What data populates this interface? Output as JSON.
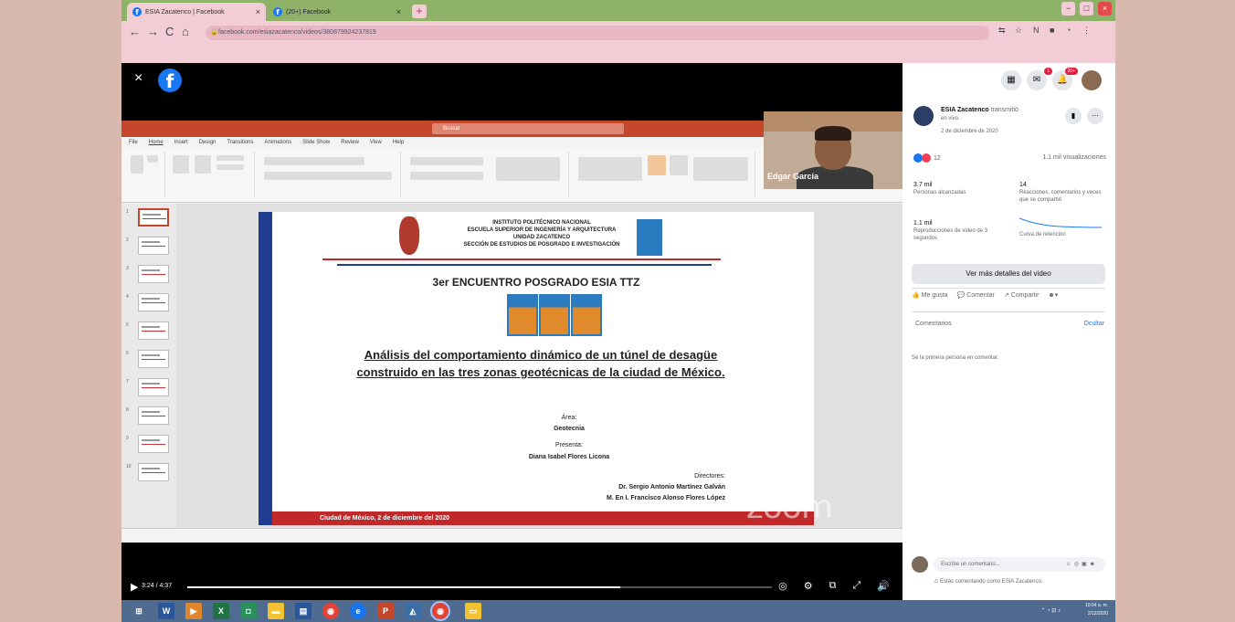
{
  "browser": {
    "tabs": [
      {
        "label": "ESIA Zacatenco | Facebook",
        "active": true
      },
      {
        "label": "(20+) Facebook",
        "active": false
      }
    ],
    "url": "facebook.com/esiazacatenco/videos/380879924237819",
    "new_tab": "+",
    "nav": {
      "back": "←",
      "forward": "→",
      "reload": "C",
      "home": "⌂"
    },
    "window_controls": [
      "−",
      "□",
      "×"
    ]
  },
  "player": {
    "close": "×",
    "logo": "f",
    "time": "3:24 / 4:37",
    "progress": 0.74,
    "icons": [
      "settings-icon",
      "fullscreen-icon",
      "expand-icon",
      "volume-icon"
    ]
  },
  "ppt": {
    "search_placeholder": "Buscar",
    "tabs": [
      "File",
      "Home",
      "Insert",
      "Design",
      "Transitions",
      "Animations",
      "Slide Show",
      "Review",
      "View",
      "Help"
    ],
    "slide_count": 10
  },
  "slide": {
    "institution": [
      "INSTITUTO POLITÉCNICO NACIONAL",
      "ESCUELA SUPERIOR DE INGENIERÍA Y ARQUITECTURA",
      "UNIDAD ZACATENCO",
      "SECCIÓN DE ESTUDIOS DE POSGRADO E INVESTIGACIÓN"
    ],
    "event": "3er ENCUENTRO POSGRADO ESIA TTZ",
    "title": "Análisis del comportamiento dinámico de un túnel de desagüe construido en las tres zonas geotécnicas de la ciudad de México.",
    "area_label": "Área:",
    "area": "Geotecnia",
    "presenta_label": "Presenta:",
    "presenter": "Diana Isabel Flores Licona",
    "directors_label": "Directores:",
    "director1": "Dr. Sergio Antonio Martínez Galván",
    "director2": "M. En I. Francisco Alonso Flores López",
    "footer": "Ciudad de México, 2 de diciembre del 2020"
  },
  "camera": {
    "name": "Edgar García"
  },
  "zoom_watermark": "zoom",
  "sidebar": {
    "page_name": "ESIA Zacatenco",
    "action": "transmitió",
    "live": "en vivo.",
    "date": "2 de diciembre de 2020",
    "reactions": "12",
    "views": "1.1 mil visualizaciones",
    "stats": [
      {
        "value": "3.7 mil",
        "label": "Personas alcanzadas"
      },
      {
        "value": "14",
        "label": "Reacciones, comentarios y veces que se compartió"
      },
      {
        "value": "1.1 mil",
        "label": "Reproducciones de video de 3 segundos"
      },
      {
        "value": "",
        "label": "Curva de retención"
      }
    ],
    "more_details": "Ver más detalles del video",
    "like": "Me gusta",
    "comment": "Comentar",
    "share": "Compartir",
    "comments_header": "Comentarios",
    "sort": "Ocultar",
    "first_comment": "Sé la primera persona en comentar.",
    "comment_placeholder": "Escribe un comentario...",
    "comment_notice": "Estás comentando como ESIA Zacatenco.",
    "top_badges": {
      "messenger": "1",
      "notifications": "20+"
    }
  },
  "taskbar": {
    "time": "10:04 a. m.",
    "date": "2/12/2020"
  }
}
